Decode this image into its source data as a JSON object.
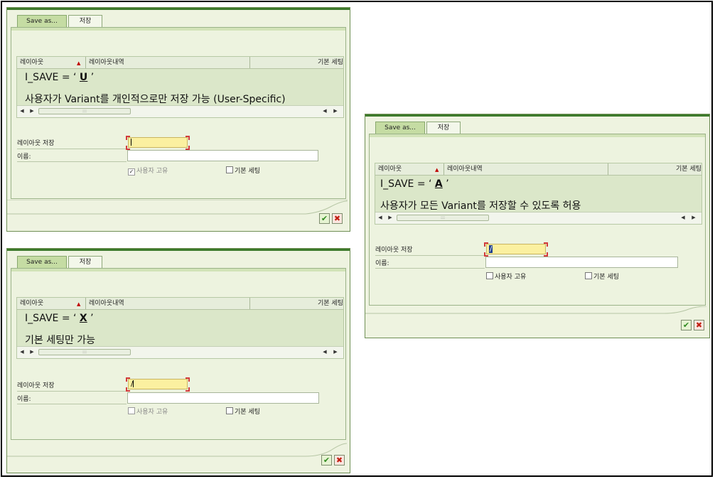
{
  "tabs": {
    "save_as": "Save as...",
    "save": "저장"
  },
  "grid": {
    "columns": [
      "레이아웃",
      "레이아웃내역",
      "기본 세팅"
    ],
    "scroll_thumb": ":::"
  },
  "form": {
    "layout_save_label": "레이아웃 저장",
    "name_label": "이름:",
    "user_specific_label": "사용자 고유",
    "default_setting_label": "기본 세팅"
  },
  "annotations": {
    "u": {
      "prefix": "I_SAVE = ‘ ",
      "code": "U",
      "suffix": " ’",
      "desc": "사용자가 Variant를 개인적으로만 저장 가능 (User-Specific)"
    },
    "a": {
      "prefix": "I_SAVE = ‘ ",
      "code": "A",
      "suffix": " ’",
      "desc": "사용자가 모든 Variant를 저장할 수 있도록 허용"
    },
    "x": {
      "prefix": "I_SAVE = ‘ ",
      "code": "X",
      "suffix": " ’",
      "desc": "기본 세팅만 가능"
    }
  },
  "field_values": {
    "u": "",
    "a": "/",
    "x": "/"
  },
  "checkboxes": {
    "u": {
      "user_specific_checked": true,
      "user_specific_disabled": true,
      "default_checked": false
    },
    "a": {
      "user_specific_checked": false,
      "user_specific_disabled": false,
      "default_checked": false
    },
    "x": {
      "user_specific_checked": false,
      "user_specific_disabled": true,
      "default_checked": false
    }
  },
  "buttons": {
    "ok": "✔",
    "cancel": "✖"
  },
  "icons": {
    "sort": "▲",
    "left": "◀",
    "right": "▶"
  },
  "colors": {
    "accent_green": "#3d7a2c",
    "input_yellow": "#fbf0a0",
    "focus_red": "#d23b3b"
  }
}
